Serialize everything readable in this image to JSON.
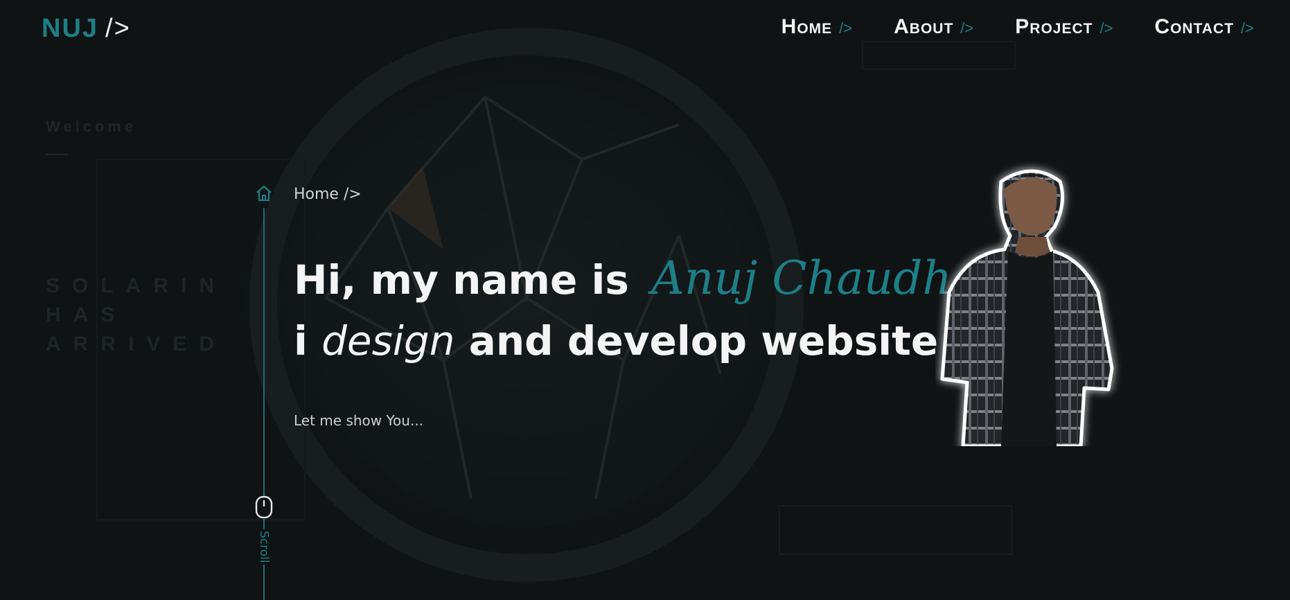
{
  "header": {
    "logo_brand": "NUJ",
    "logo_tag": "/>",
    "nav": [
      {
        "label": "Home",
        "suffix": "/>"
      },
      {
        "label": "About",
        "suffix": "/>"
      },
      {
        "label": "Project",
        "suffix": "/>"
      },
      {
        "label": "Contact",
        "suffix": "/>"
      }
    ]
  },
  "hero": {
    "breadcrumb": "Home />",
    "line1_prefix": "Hi, my name is",
    "name": "Anuj Chaudhari",
    "line2_prefix": "i",
    "line2_emphasis": "design",
    "line2_suffix": "and develop website",
    "subtitle": "Let me show You..."
  },
  "rail": {
    "scroll_label": "Scroll"
  },
  "icons": {
    "home": "home-icon",
    "scroll": "mouse-icon"
  },
  "colors": {
    "accent": "#1e7f86",
    "background": "#0f1314",
    "text": "#f4f4f4"
  }
}
